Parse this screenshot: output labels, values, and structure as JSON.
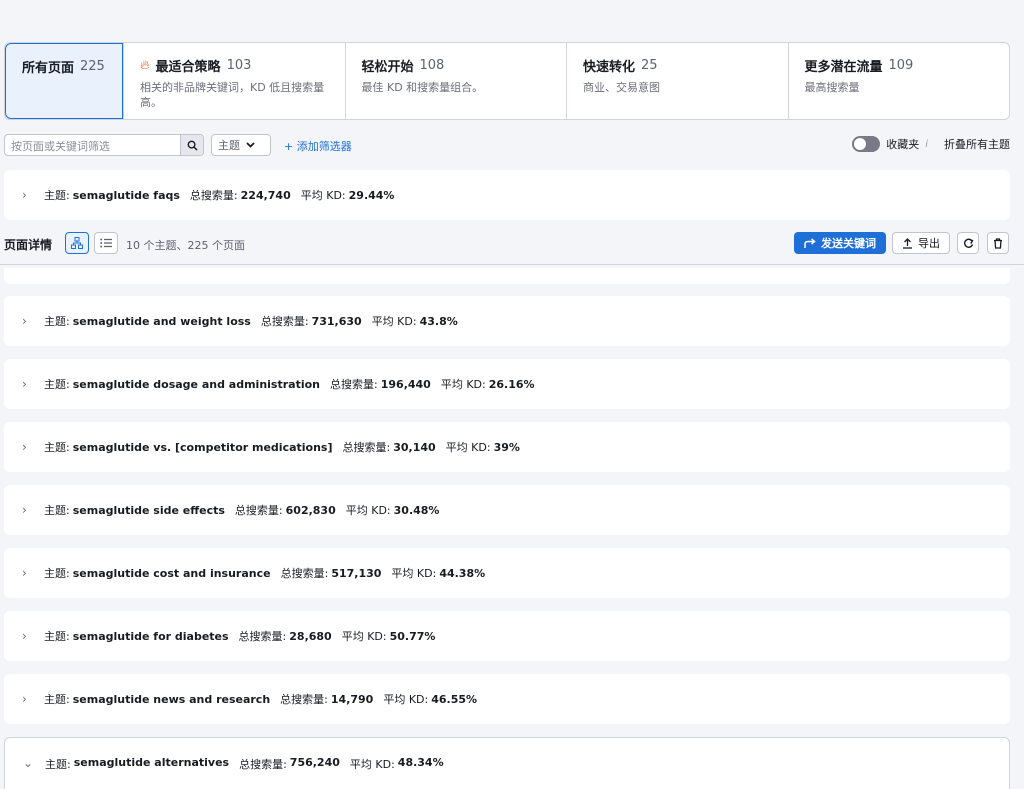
{
  "tabs": [
    {
      "title": "所有页面",
      "count": "225",
      "desc": ""
    },
    {
      "title": "最适合策略",
      "count": "103",
      "desc": "相关的非品牌关键词，KD 低且搜索量高。",
      "icon": "fire-icon"
    },
    {
      "title": "轻松开始",
      "count": "108",
      "desc": "最佳 KD 和搜索量组合。"
    },
    {
      "title": "快速转化",
      "count": "25",
      "desc": "商业、交易意图"
    },
    {
      "title": "更多潜在流量",
      "count": "109",
      "desc": "最高搜索量"
    }
  ],
  "filters": {
    "search_placeholder": "按页面或关键词筛选",
    "topic_label": "主题",
    "add_filter": "+ 添加筛选器",
    "favorites_label": "收藏夹",
    "info": "i",
    "collapse_all": "折叠所有主题"
  },
  "labels": {
    "topic_prefix": "主题:",
    "volume_prefix": "总搜索量:",
    "kd_prefix": "平均 KD:"
  },
  "first_topic": {
    "name": "semaglutide faqs",
    "volume": "224,740",
    "kd": "29.44%"
  },
  "details": {
    "title": "页面详情",
    "count": "10 个主题、225 个页面",
    "send_label": "发送关键词",
    "export_label": "导出"
  },
  "topics": [
    {
      "name": "semaglutide and weight loss",
      "volume": "731,630",
      "kd": "43.8%",
      "expanded": false
    },
    {
      "name": "semaglutide dosage and administration",
      "volume": "196,440",
      "kd": "26.16%",
      "expanded": false
    },
    {
      "name": "semaglutide vs. [competitor medications]",
      "volume": "30,140",
      "kd": "39%",
      "expanded": false
    },
    {
      "name": "semaglutide side effects",
      "volume": "602,830",
      "kd": "30.48%",
      "expanded": false
    },
    {
      "name": "semaglutide cost and insurance",
      "volume": "517,130",
      "kd": "44.38%",
      "expanded": false
    },
    {
      "name": "semaglutide for diabetes",
      "volume": "28,680",
      "kd": "50.77%",
      "expanded": false
    },
    {
      "name": "semaglutide news and research",
      "volume": "14,790",
      "kd": "46.55%",
      "expanded": false
    },
    {
      "name": "semaglutide alternatives",
      "volume": "756,240",
      "kd": "48.34%",
      "expanded": true
    }
  ]
}
